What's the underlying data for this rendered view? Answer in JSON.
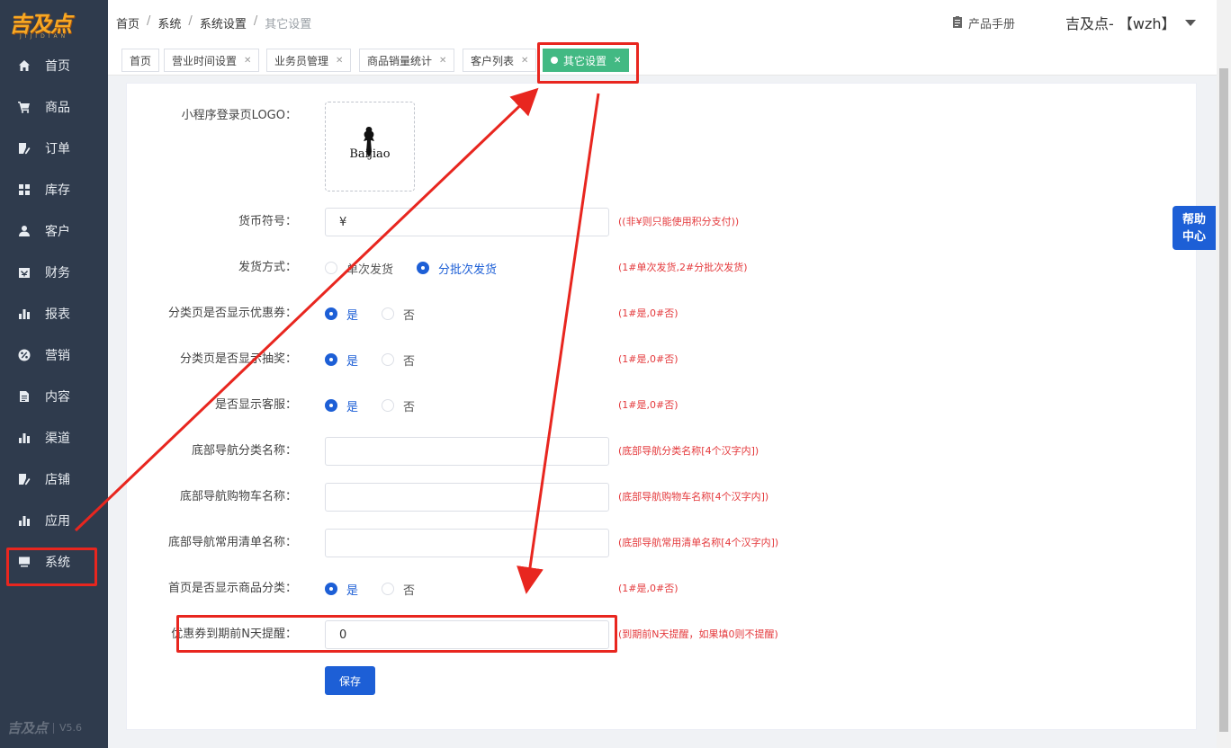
{
  "brand": {
    "logo_text": "吉及点",
    "logo_sub": "JIJIDIAN",
    "version": "V5.6"
  },
  "sidebar": {
    "items": [
      {
        "label": "首页",
        "icon": "home-icon"
      },
      {
        "label": "商品",
        "icon": "cart-icon"
      },
      {
        "label": "订单",
        "icon": "order-icon"
      },
      {
        "label": "库存",
        "icon": "grid-icon"
      },
      {
        "label": "客户",
        "icon": "user-icon"
      },
      {
        "label": "财务",
        "icon": "wallet-icon"
      },
      {
        "label": "报表",
        "icon": "bar-chart-icon"
      },
      {
        "label": "营销",
        "icon": "percent-icon"
      },
      {
        "label": "内容",
        "icon": "document-icon"
      },
      {
        "label": "渠道",
        "icon": "bar-chart-icon"
      },
      {
        "label": "店铺",
        "icon": "edit-icon"
      },
      {
        "label": "应用",
        "icon": "bar-chart-icon"
      },
      {
        "label": "系统",
        "icon": "monitor-icon"
      }
    ],
    "active": "系统"
  },
  "header": {
    "breadcrumb": [
      "首页",
      "系统",
      "系统设置",
      "其它设置"
    ],
    "manual_label": "产品手册",
    "user_label": "吉及点- 【wzh】"
  },
  "tabs": [
    {
      "label": "首页",
      "closable": false
    },
    {
      "label": "营业时间设置",
      "closable": true
    },
    {
      "label": "业务员管理",
      "closable": true
    },
    {
      "label": "商品销量统计",
      "closable": true
    },
    {
      "label": "客户列表",
      "closable": true
    },
    {
      "label": "其它设置",
      "closable": true,
      "active": true
    }
  ],
  "form": {
    "logo": {
      "label": "小程序登录页LOGO：",
      "image_text": "Baijiao"
    },
    "currency": {
      "label": "货币符号：",
      "value": "¥",
      "hint": "((非¥则只能使用积分支付))"
    },
    "delivery": {
      "label": "发货方式：",
      "options": [
        "单次发货",
        "分批次发货"
      ],
      "selected": "分批次发货",
      "hint": "(1#单次发货,2#分批次发货)"
    },
    "show_coupon": {
      "label": "分类页是否显示优惠券：",
      "options": [
        "是",
        "否"
      ],
      "selected": "是",
      "hint": "(1#是,0#否)"
    },
    "show_lottery": {
      "label": "分类页是否显示抽奖：",
      "options": [
        "是",
        "否"
      ],
      "selected": "是",
      "hint": "(1#是,0#否)"
    },
    "show_service": {
      "label": "是否显示客服：",
      "options": [
        "是",
        "否"
      ],
      "selected": "是",
      "hint": "(1#是,0#否)"
    },
    "nav_category": {
      "label": "底部导航分类名称：",
      "value": "",
      "hint": "(底部导航分类名称[4个汉字内])"
    },
    "nav_cart": {
      "label": "底部导航购物车名称：",
      "value": "",
      "hint": "(底部导航购物车名称[4个汉字内])"
    },
    "nav_list": {
      "label": "底部导航常用清单名称：",
      "value": "",
      "hint": "(底部导航常用清单名称[4个汉字内])"
    },
    "home_category": {
      "label": "首页是否显示商品分类：",
      "options": [
        "是",
        "否"
      ],
      "selected": "是",
      "hint": "(1#是,0#否)"
    },
    "coupon_remind": {
      "label": "优惠券到期前N天提醒：",
      "value": "0",
      "hint": "(到期前N天提醒，如果填0则不提醒)"
    },
    "save_label": "保存"
  },
  "help": {
    "line1": "帮助",
    "line2": "中心"
  },
  "colors": {
    "sidebar_bg": "#2f3b4d",
    "primary": "#1d5fd6",
    "tab_active": "#42b983",
    "hint": "#e4393c",
    "annotation": "#e8261f"
  }
}
